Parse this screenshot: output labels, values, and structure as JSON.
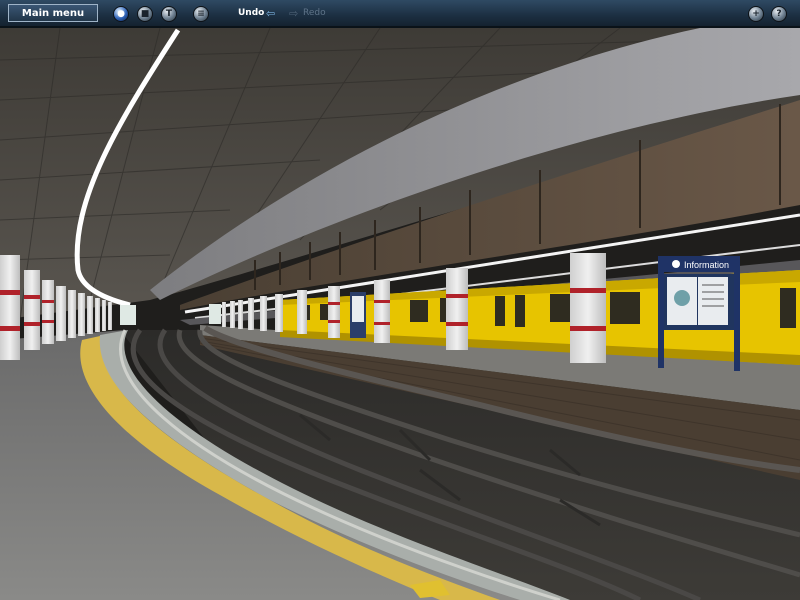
{
  "toolbar": {
    "main_menu_label": "Main menu",
    "undo_label": "Undo",
    "redo_label": "Redo",
    "icons": [
      "globe-icon",
      "stop-icon",
      "tools-icon",
      "list-icon",
      "add-icon",
      "help-icon"
    ]
  },
  "scene": {
    "sign_title": "Information",
    "colors": {
      "train_body": "#e8c400",
      "platform_edge": "#d8b84a",
      "pillar_band": "#b0222a"
    }
  }
}
